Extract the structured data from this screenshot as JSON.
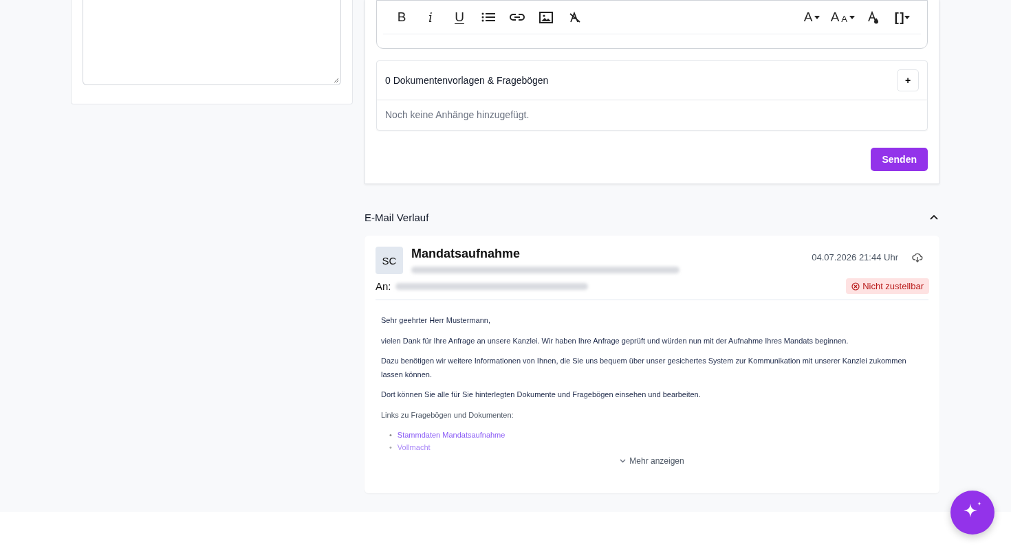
{
  "toolbar": {
    "left": [
      {
        "kind": "glyph",
        "label": "B"
      },
      {
        "kind": "glyph",
        "label": "i"
      },
      {
        "kind": "glyph",
        "label": "U"
      },
      {
        "kind": "icon"
      },
      {
        "kind": "icon"
      },
      {
        "kind": "icon"
      },
      {
        "kind": "icon"
      }
    ],
    "right": [
      {
        "kind": "glyph",
        "label": "A"
      },
      {
        "kind": "glyph",
        "label": "A",
        "small": "A"
      },
      {
        "kind": "icon"
      },
      {
        "kind": "glyph",
        "label": "[ ]"
      }
    ]
  },
  "attachments": {
    "title": "0 Dokumentenvorlagen & Fragebögen",
    "add": "+",
    "empty": "Noch keine Anhänge hinzugefügt."
  },
  "send_button": "Senden",
  "history": {
    "title": "E-Mail Verlauf",
    "expanded": true,
    "email": {
      "initials": "SC",
      "subject": "Mandatsaufnahme",
      "date": "04.07.2026 21:44 Uhr",
      "to_label": "An:",
      "status": "Nicht zustellbar",
      "paragraphs": [
        "Sehr geehrter Herr Mustermann,",
        "vielen Dank für Ihre Anfrage an unsere Kanzlei. Wir haben Ihre Anfrage geprüft und würden nun mit der Aufnahme Ihres Mandats beginnen.",
        "Dazu benötigen wir weitere Informationen von Ihnen, die Sie uns bequem über unser gesichertes System zur Kommunikation mit unserer Kanzlei zukommen lassen können.",
        "Dort können Sie alle für Sie hinterlegten Dokumente und Fragebögen einsehen und bearbeiten.",
        "Links zu Fragebögen und Dokumenten:"
      ],
      "bullet": "•",
      "links": [
        "Stammdaten Mandatsaufnahme",
        "Vollmacht"
      ],
      "more": "Mehr anzeigen"
    }
  }
}
